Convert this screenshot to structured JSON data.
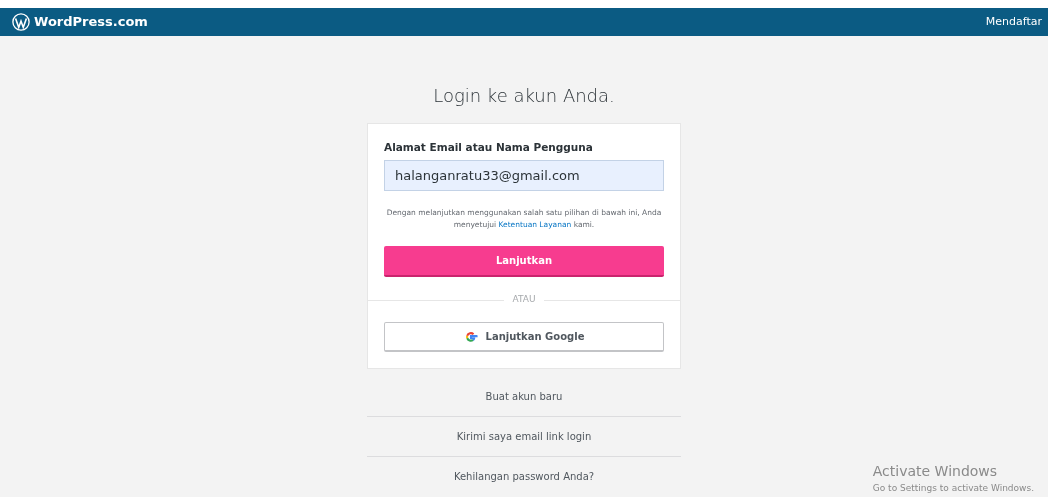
{
  "header": {
    "logo_text": "WordPress.com",
    "signup_link": "Mendaftar"
  },
  "title": "Login ke akun Anda.",
  "form": {
    "field_label": "Alamat Email atau Nama Pengguna",
    "field_value": "halanganratu33@gmail.com",
    "terms_before": "Dengan melanjutkan menggunakan salah satu pilihan di bawah ini, Anda menyetujui ",
    "terms_link": "Ketentuan Layanan",
    "terms_after": " kami.",
    "continue_button": "Lanjutkan",
    "divider_text": "ATAU",
    "google_button": "Lanjutkan Google"
  },
  "links": [
    "Buat akun baru",
    "Kirimi saya email link login",
    "Kehilangan password Anda?"
  ],
  "activation_notice": {
    "title": "Activate Windows",
    "subtitle": "Go to Settings to activate Windows."
  }
}
